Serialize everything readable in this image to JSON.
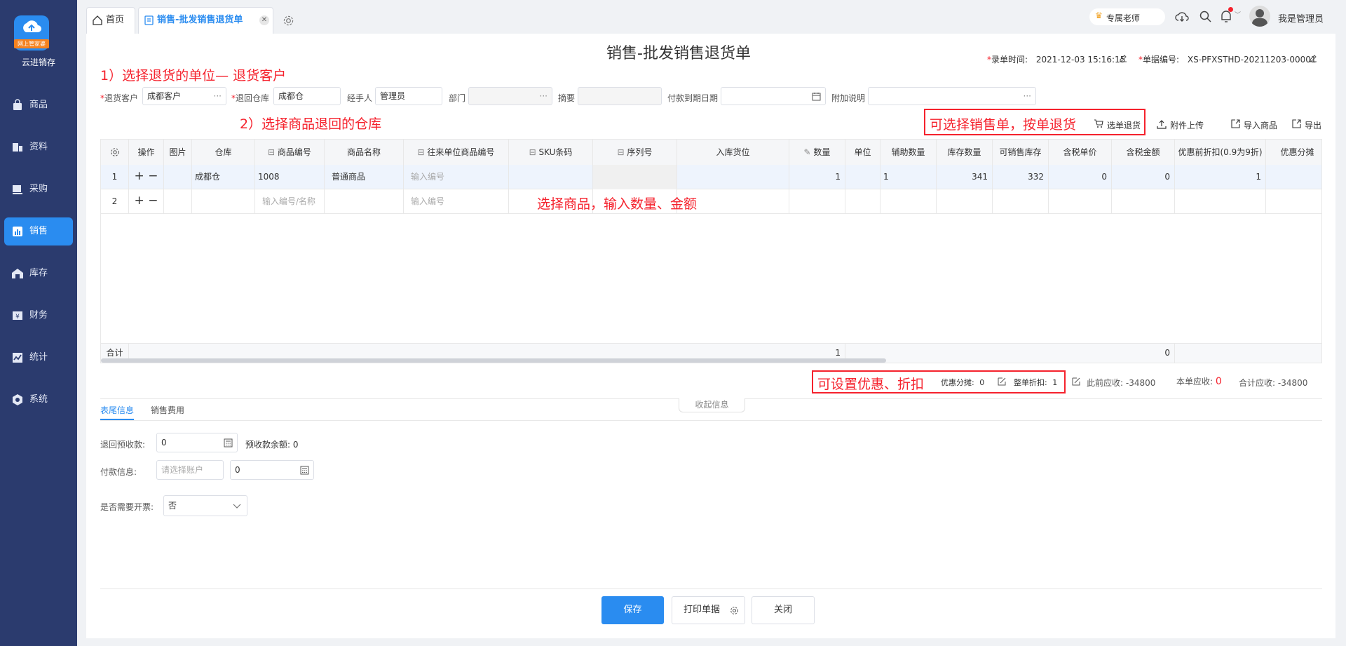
{
  "sidebar": {
    "logo_tag": "网上管家婆",
    "app_name": "云进销存",
    "items": [
      {
        "label": "商品",
        "icon": "bag-icon"
      },
      {
        "label": "资料",
        "icon": "book-icon"
      },
      {
        "label": "采购",
        "icon": "cart-icon"
      },
      {
        "label": "销售",
        "icon": "chart-icon"
      },
      {
        "label": "库存",
        "icon": "warehouse-icon"
      },
      {
        "label": "财务",
        "icon": "finance-icon"
      },
      {
        "label": "统计",
        "icon": "trend-icon"
      },
      {
        "label": "系统",
        "icon": "gear-icon"
      }
    ],
    "active_index": 3
  },
  "tabs": [
    {
      "label": "首页"
    },
    {
      "label": "销售-批发销售退货单"
    }
  ],
  "top_right": {
    "teacher": "专属老师",
    "user": "我是管理员"
  },
  "doc": {
    "title": "销售-批发销售退货单",
    "entry_time_label": "录单时间:",
    "entry_time": "2021-12-03 15:16:15",
    "doc_no_label": "单据编号:",
    "doc_no": "XS-PFXSTHD-20211203-00001"
  },
  "form": {
    "customer_label": "退货客户",
    "customer_value": "成都客户",
    "warehouse_label": "退回仓库",
    "warehouse_value": "成都仓",
    "handler_label": "经手人",
    "handler_value": "管理员",
    "dept_label": "部门",
    "summary_label": "摘要",
    "due_label": "付款到期日期",
    "remark_label": "附加说明"
  },
  "annotations": {
    "a1": "1）选择退货的单位— 退货客户",
    "a2": "2）选择商品退回的仓库",
    "a3": "可选择销售单，按单退货",
    "a4": "选择商品，输入数量、金额",
    "a5": "可设置优惠、折扣"
  },
  "toolbar": {
    "select_doc": "选单退货",
    "upload": "附件上传",
    "import": "导入商品",
    "export": "导出"
  },
  "grid": {
    "headers": [
      "操作",
      "图片",
      "仓库",
      "商品编号",
      "商品名称",
      "往来单位商品编号",
      "SKU条码",
      "序列号",
      "入库货位",
      "数量",
      "单位",
      "辅助数量",
      "库存数量",
      "可销售库存",
      "含税单价",
      "含税金额",
      "优惠前折扣(0.9为9折)",
      "优惠分摊"
    ],
    "row1": {
      "no": "1",
      "warehouse": "成都仓",
      "code": "1008",
      "name": "普通商品",
      "partner_code_ph": "输入编号",
      "qty": "1",
      "aux_qty": "1",
      "stock": "341",
      "saleable": "332",
      "price": "0",
      "amount": "0",
      "discount": "1"
    },
    "row2": {
      "no": "2",
      "code_ph": "输入编号/名称",
      "partner_code_ph": "输入编号"
    },
    "total_label": "合计",
    "total_qty": "1",
    "total_amount": "0"
  },
  "summary": {
    "discount_share_label": "优惠分摊:",
    "discount_share": "0",
    "whole_discount_label": "整单折扣:",
    "whole_discount": "1",
    "prev_recv_label": "此前应收:",
    "prev_recv": "-34800",
    "this_recv_label": "本单应收:",
    "this_recv": "0",
    "total_recv_label": "合计应收:",
    "total_recv": "-34800",
    "collapse": "收起信息"
  },
  "footer_tabs": [
    "表尾信息",
    "销售费用"
  ],
  "footer": {
    "prepay_label": "退回预收款:",
    "prepay_value": "0",
    "prepay_balance_label": "预收款余额:",
    "prepay_balance": "0",
    "payment_label": "付款信息:",
    "account_ph": "请选择账户",
    "payment_value": "0",
    "invoice_label": "是否需要开票:",
    "invoice_value": "否"
  },
  "buttons": {
    "save": "保存",
    "print": "打印单据",
    "close": "关闭"
  }
}
